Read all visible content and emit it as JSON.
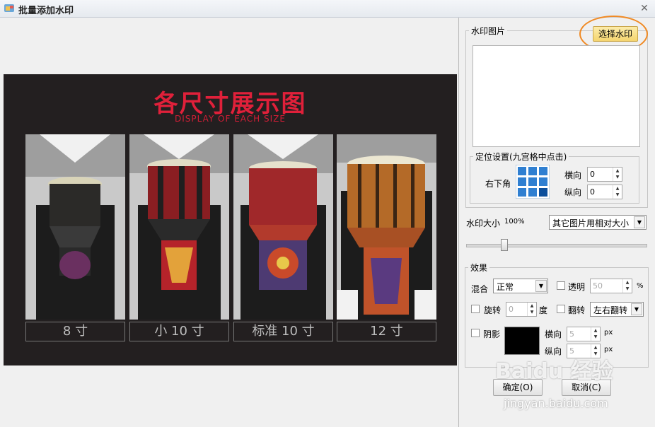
{
  "window": {
    "title": "批量添加水印",
    "close_icon": "close-icon"
  },
  "preview": {
    "title": "各尺寸展示图",
    "subtitle": "DISPLAY OF EACH SIZE",
    "captions": [
      "8 寸",
      "小 10 寸",
      "标准 10 寸",
      "12 寸"
    ]
  },
  "panel": {
    "watermark_image_legend": "水印图片",
    "select_watermark_label": "选择水印",
    "position_legend": "定位设置(九宫格中点击)",
    "position_value": "右下角",
    "horizontal_label": "横向",
    "vertical_label": "纵向",
    "horizontal_value": "0",
    "vertical_value": "0",
    "size_label": "水印大小",
    "size_value": "100%",
    "size_mode": "其它图片用相对大小",
    "effects_legend": "效果",
    "blend_label": "混合",
    "blend_value": "正常",
    "transparency_label": "透明",
    "transparency_value": "50",
    "percent": "%",
    "rotate_label": "旋转",
    "rotate_value": "0",
    "degree": "度",
    "flip_label": "翻转",
    "flip_value": "左右翻转",
    "shadow_label": "阴影",
    "shadow_h_label": "横向",
    "shadow_v_label": "纵向",
    "shadow_h_value": "5",
    "shadow_v_value": "5",
    "px": "px",
    "ok_label": "确定(O)",
    "cancel_label": "取消(C)"
  },
  "overlay": {
    "brand": "Baidu 经验",
    "url": "jingyan.baidu.com"
  },
  "colors": {
    "accent": "#e0203a",
    "highlight_ring": "#f08a24",
    "select_btn_bg": "#f9e28b"
  }
}
